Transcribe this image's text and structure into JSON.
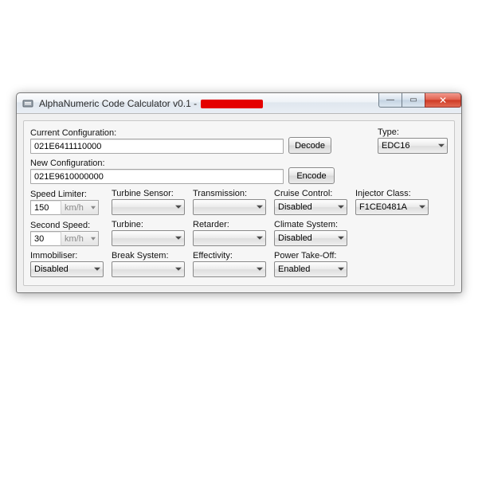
{
  "titlebar": {
    "title_prefix": "AlphaNumeric Code Calculator v0.1 - "
  },
  "winbtns": {
    "min": "—",
    "max": "▭",
    "close": "✕"
  },
  "top": {
    "current_cfg_label": "Current Configuration:",
    "current_cfg_value": "021E6411110000",
    "decode_label": "Decode",
    "new_cfg_label": "New Configuration:",
    "new_cfg_value": "021E9610000000",
    "encode_label": "Encode",
    "type_label": "Type:",
    "type_value": "EDC16"
  },
  "grid": {
    "speed_limiter": {
      "label": "Speed Limiter:",
      "value": "150",
      "unit": "km/h"
    },
    "turbine_sensor": {
      "label": "Turbine Sensor:",
      "value": ""
    },
    "transmission": {
      "label": "Transmission:",
      "value": ""
    },
    "cruise_control": {
      "label": "Cruise Control:",
      "value": "Disabled"
    },
    "injector_class": {
      "label": "Injector Class:",
      "value": "F1CE0481A"
    },
    "second_speed": {
      "label": "Second Speed:",
      "value": "30",
      "unit": "km/h"
    },
    "turbine": {
      "label": "Turbine:",
      "value": ""
    },
    "retarder": {
      "label": "Retarder:",
      "value": ""
    },
    "climate_system": {
      "label": "Climate System:",
      "value": "Disabled"
    },
    "immobiliser": {
      "label": "Immobiliser:",
      "value": "Disabled"
    },
    "break_system": {
      "label": "Break System:",
      "value": ""
    },
    "effectivity": {
      "label": "Effectivity:",
      "value": ""
    },
    "power_takeoff": {
      "label": "Power Take-Off:",
      "value": "Enabled"
    }
  }
}
